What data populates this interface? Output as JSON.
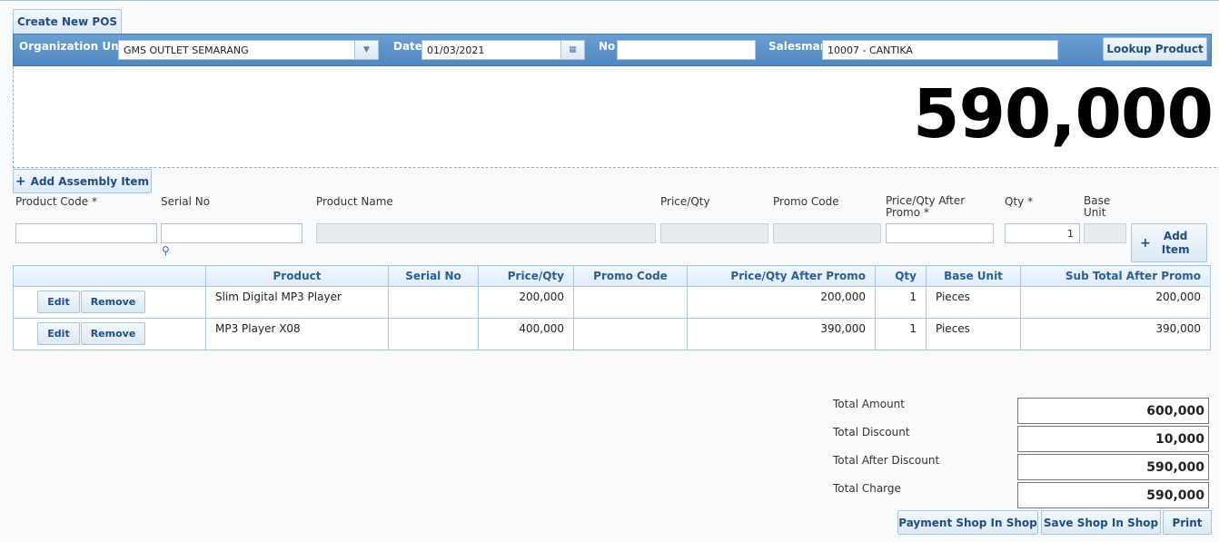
{
  "header": {
    "create_button": "Create New POS"
  },
  "toolbar": {
    "org_label": "Organization Unit",
    "org_value": "GMS OUTLET SEMARANG",
    "date_label": "Date",
    "date_value": "01/03/2021",
    "no_label": "No",
    "no_value": "",
    "salesman_label": "Salesman",
    "salesman_value": "10007 - CANTIKA",
    "lookup_button": "Lookup Product"
  },
  "display": {
    "total": "590,000"
  },
  "entry": {
    "add_assembly_button": "Add Assembly Item",
    "labels": {
      "product_code": "Product Code",
      "serial_no": "Serial No",
      "product_name": "Product Name",
      "price_qty": "Price/Qty",
      "promo_code": "Promo Code",
      "price_after_promo_1": "Price/Qty After",
      "price_after_promo_2": "Promo",
      "qty": "Qty",
      "base_unit_1": "Base",
      "base_unit_2": "Unit",
      "required_mark": "*"
    },
    "values": {
      "qty": "1"
    },
    "add_item_1": "Add",
    "add_item_2": "Item"
  },
  "grid": {
    "columns": [
      "Product",
      "Serial No",
      "Price/Qty",
      "Promo Code",
      "Price/Qty After Promo",
      "Qty",
      "Base Unit",
      "Sub Total After Promo"
    ],
    "edit_label": "Edit",
    "remove_label": "Remove",
    "rows": [
      {
        "product": "Slim Digital MP3 Player",
        "serial": "",
        "price": "200,000",
        "promo": "",
        "after_promo": "200,000",
        "qty": "1",
        "unit": "Pieces",
        "subtotal": "200,000"
      },
      {
        "product": "MP3 Player X08",
        "serial": "",
        "price": "400,000",
        "promo": "",
        "after_promo": "390,000",
        "qty": "1",
        "unit": "Pieces",
        "subtotal": "390,000"
      }
    ]
  },
  "totals": {
    "amount_label": "Total Amount",
    "amount": "600,000",
    "discount_label": "Total Discount",
    "discount": "10,000",
    "after_discount_label": "Total After Discount",
    "after_discount": "590,000",
    "charge_label": "Total Charge",
    "charge": "590,000"
  },
  "footer": {
    "payment_button": "Payment Shop In Shop",
    "save_button": "Save Shop In Shop",
    "print_button": "Print"
  }
}
